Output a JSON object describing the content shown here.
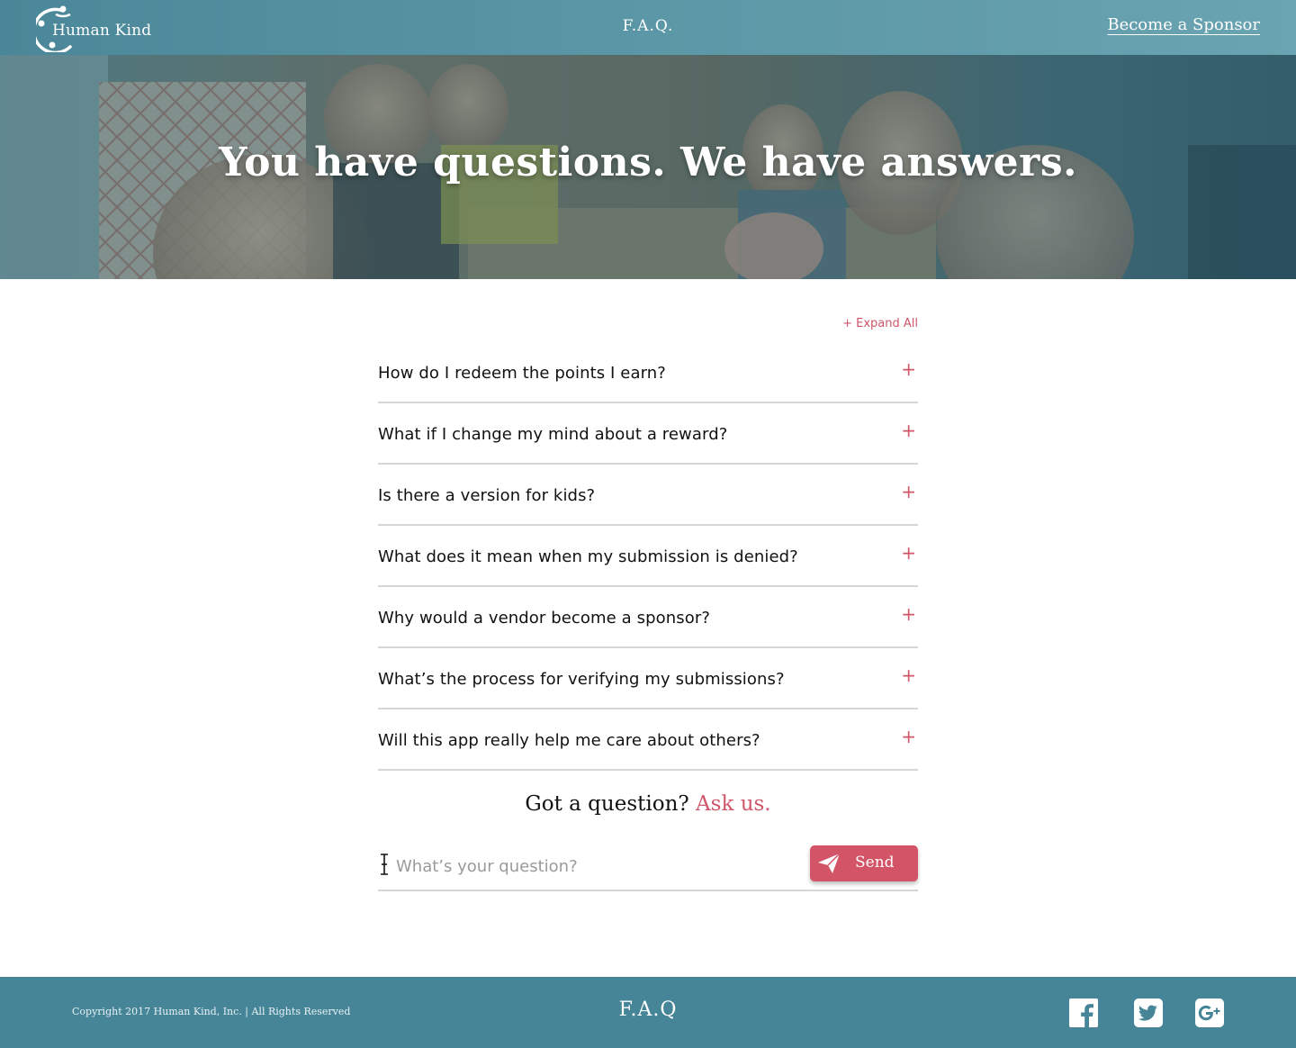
{
  "header": {
    "logo_text": "Human Kind",
    "nav_faq": "F.A.Q.",
    "sponsor_link": "Become a Sponsor"
  },
  "hero": {
    "title": "You have questions. We have answers."
  },
  "faq": {
    "expand_all": "+ Expand All",
    "items": [
      {
        "question": "How do I redeem the points I earn?",
        "toggle": "+"
      },
      {
        "question": "What if I change my mind about a reward?",
        "toggle": "+"
      },
      {
        "question": "Is there a version for kids?",
        "toggle": "+"
      },
      {
        "question": "What does it mean when my submission is denied?",
        "toggle": "+"
      },
      {
        "question": "Why would a vendor become a sponsor?",
        "toggle": "+"
      },
      {
        "question": "What’s the process for verifying my submissions?",
        "toggle": "+"
      },
      {
        "question": "Will this app really help me care about others?",
        "toggle": "+"
      }
    ]
  },
  "ask": {
    "title_prefix": "Got a question?",
    "title_accent": "Ask us.",
    "input_placeholder": "What’s your question?",
    "input_value": "",
    "send_label": "Send"
  },
  "footer": {
    "copyright": "Copyright 2017 Human Kind, Inc. | All Rights Reserved",
    "faq": "F.A.Q",
    "social": [
      "facebook-icon",
      "twitter-icon",
      "google-plus-icon"
    ]
  },
  "colors": {
    "header_teal": "#5b97a6",
    "footer_teal": "#468597",
    "accent_red": "#d0566a"
  }
}
